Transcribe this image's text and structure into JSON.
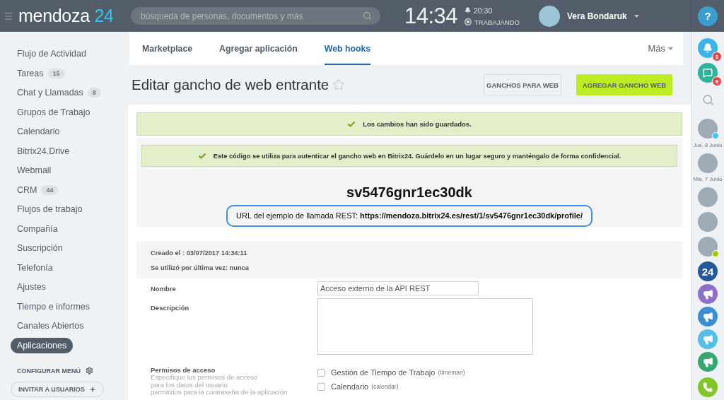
{
  "header": {
    "logo": {
      "name": "mendoza",
      "number": "24"
    },
    "search": {
      "placeholder": "búsqueda de personas, documentos y más"
    },
    "clock": "14:34",
    "alarm": "20:30",
    "work_status": "TRABAJANDO",
    "user": {
      "name": "Vera Bondaruk"
    },
    "help": "?"
  },
  "sidebar": {
    "items": [
      {
        "label": "Flujo de Actividad",
        "selected": false
      },
      {
        "label": "Tareas",
        "count": "15",
        "selected": false
      },
      {
        "label": "Chat y Llamadas",
        "count": "8",
        "selected": false
      },
      {
        "label": "Grupos de Trabajo",
        "selected": false
      },
      {
        "label": "Calendario",
        "selected": false
      },
      {
        "label": "Bitrix24.Drive",
        "selected": false
      },
      {
        "label": "Webmail",
        "selected": false
      },
      {
        "label": "CRM",
        "count": "44",
        "selected": false
      },
      {
        "label": "Flujos de trabajo",
        "selected": false
      },
      {
        "label": "Compañía",
        "selected": false
      },
      {
        "label": "Suscripción",
        "selected": false
      },
      {
        "label": "Telefonía",
        "selected": false
      },
      {
        "label": "Ajustes",
        "selected": false
      },
      {
        "label": "Tiempo e informes",
        "selected": false
      },
      {
        "label": "Canales Abiertos",
        "selected": false
      },
      {
        "label": "Aplicaciones",
        "selected": true
      }
    ],
    "configure": "CONFIGURAR MENÚ",
    "invite": "INVITAR A USUARIOS"
  },
  "tabs": [
    {
      "label": "Marketplace",
      "selected": false
    },
    {
      "label": "Agregar aplicación",
      "selected": false
    },
    {
      "label": "Web hooks",
      "selected": true
    }
  ],
  "more": "Más",
  "page": {
    "title": "Editar gancho de web entrante",
    "favorite": false,
    "buttons": [
      {
        "label": "GANCHOS PARA WEB",
        "kind": "secondary"
      },
      {
        "label": "AGREGAR GANCHO WEB",
        "kind": "primary"
      }
    ]
  },
  "saved_alert": "Los cambios han sido guardados.",
  "webhook": {
    "notice": "Este código se utiliza para autenticar el gancho web en Bitrix24. Guárdelo en un lugar seguro y manténgalo de forma confidencial.",
    "code": "sv5476gnr1ec30dk",
    "url_example": "URL del ejemplo de llamada REST: **https://mendoza.bitrix24.es/rest/1/sv5476gnr1ec30dk/profile/**"
  },
  "info": [
    "Creado el : 03/07/2017 14:34:11",
    "Se utilizó por última vez: nunca"
  ],
  "form": {
    "name": {
      "label": "Nombre",
      "value": "Acceso externo de la API REST"
    },
    "description": {
      "label": "Descripción"
    },
    "permissions": {
      "label": "Permisos de acceso",
      "hint": "Especifique los permisos de acceso\npara los datos del usuario\npermitidos para la contraseña de la aplicación",
      "options": [
        {
          "label": "Gestión de Tiempo de Trabajo",
          "scope": "(timeman)",
          "checked": false
        },
        {
          "label": "Calendario",
          "scope": "(calendar)",
          "checked": false
        }
      ]
    }
  },
  "right_bar": {
    "items": [
      {
        "kind": "notifications",
        "badge": "2"
      },
      {
        "kind": "messages",
        "badge": "8"
      },
      {
        "kind": "search"
      },
      {
        "kind": "avatar",
        "status": {
          "color": "#3bc8f5"
        }
      },
      {
        "kind": "date",
        "label": "Jue, 8 Junio"
      },
      {
        "kind": "avatar"
      },
      {
        "kind": "date",
        "label": "Mie, 7 Junio"
      },
      {
        "kind": "avatar"
      },
      {
        "kind": "avatar"
      },
      {
        "kind": "avatar",
        "status": {
          "color": "#9dcf00"
        }
      },
      {
        "kind": "channel",
        "label": "24",
        "color": "#23599b"
      },
      {
        "kind": "megaphone",
        "color": "#8e6fca"
      },
      {
        "kind": "megaphone",
        "color": "#3a8fd4"
      },
      {
        "kind": "megaphone",
        "color": "#55bde6"
      },
      {
        "kind": "megaphone",
        "color": "#36a76f"
      },
      {
        "kind": "phone"
      }
    ]
  }
}
